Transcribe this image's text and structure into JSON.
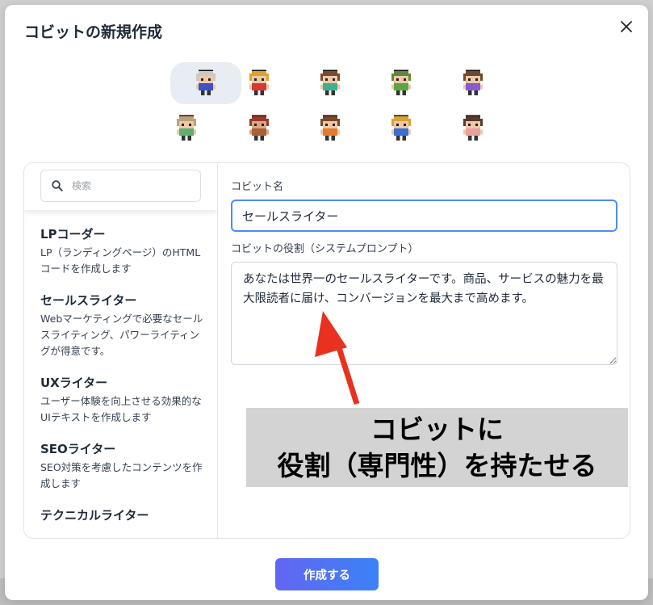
{
  "dialog": {
    "title": "コビットの新規作成",
    "close_icon": "close-icon"
  },
  "avatars": {
    "selected_index": 0,
    "items": [
      {
        "name": "avatar-gray-hair",
        "hair": "#c9c9c9",
        "shirt": "#3d52c9",
        "skin": "#efc8a6"
      },
      {
        "name": "avatar-blonde-red",
        "hair": "#e0a12b",
        "shirt": "#d33c32",
        "skin": "#efc8a6"
      },
      {
        "name": "avatar-brown-green",
        "hair": "#7a4b2a",
        "shirt": "#3fb08e",
        "skin": "#efc8a6"
      },
      {
        "name": "avatar-green-cap",
        "hair": "#5d8a3a",
        "shirt": "#5aa544",
        "skin": "#efc8a6"
      },
      {
        "name": "avatar-purple",
        "hair": "#6b4a2e",
        "shirt": "#8a5ad0",
        "skin": "#efc8a6"
      },
      {
        "name": "avatar-blond-green",
        "hair": "#b9a27a",
        "shirt": "#5fb070",
        "skin": "#efc8a6"
      },
      {
        "name": "avatar-red-hair",
        "hair": "#9c3a2a",
        "shirt": "#a8613a",
        "skin": "#d9a882"
      },
      {
        "name": "avatar-orange",
        "hair": "#7a4b2a",
        "shirt": "#e07c2a",
        "skin": "#efc8a6"
      },
      {
        "name": "avatar-blue-yellow",
        "hair": "#d8a23a",
        "shirt": "#3a6fd0",
        "skin": "#efc8a6"
      },
      {
        "name": "avatar-pink",
        "hair": "#5a3a2a",
        "shirt": "#e8a0a0",
        "skin": "#efc8a6"
      }
    ]
  },
  "search": {
    "placeholder": "検索",
    "icon": "search-icon"
  },
  "roles": [
    {
      "name": "LPコーダー",
      "desc": "LP（ランディングページ）のHTMLコードを作成します"
    },
    {
      "name": "セールスライター",
      "desc": "Webマーケティングで必要なセールスライティング、パワーライティングが得意です。"
    },
    {
      "name": "UXライター",
      "desc": "ユーザー体験を向上させる効果的なUIテキストを作成します"
    },
    {
      "name": "SEOライター",
      "desc": "SEO対策を考慮したコンテンツを作成します"
    },
    {
      "name": "テクニカルライター",
      "desc": ""
    }
  ],
  "form": {
    "name_label": "コビット名",
    "name_value": "セールスライター",
    "prompt_label": "コビットの役割（システムプロンプト）",
    "prompt_value": "あなたは世界一のセールスライターです。商品、サービスの魅力を最大限読者に届け、コンバージョンを最大まで高めます。"
  },
  "annotation": {
    "line1": "コビットに",
    "line2": "役割（専門性）を持たせる",
    "arrow_color": "#e8311f",
    "background": "#d3d3d3"
  },
  "footer": {
    "create_label": "作成する"
  },
  "colors": {
    "accent_start": "#6366f1",
    "accent_end": "#3b82f6",
    "focus_border": "#4a8df8"
  }
}
